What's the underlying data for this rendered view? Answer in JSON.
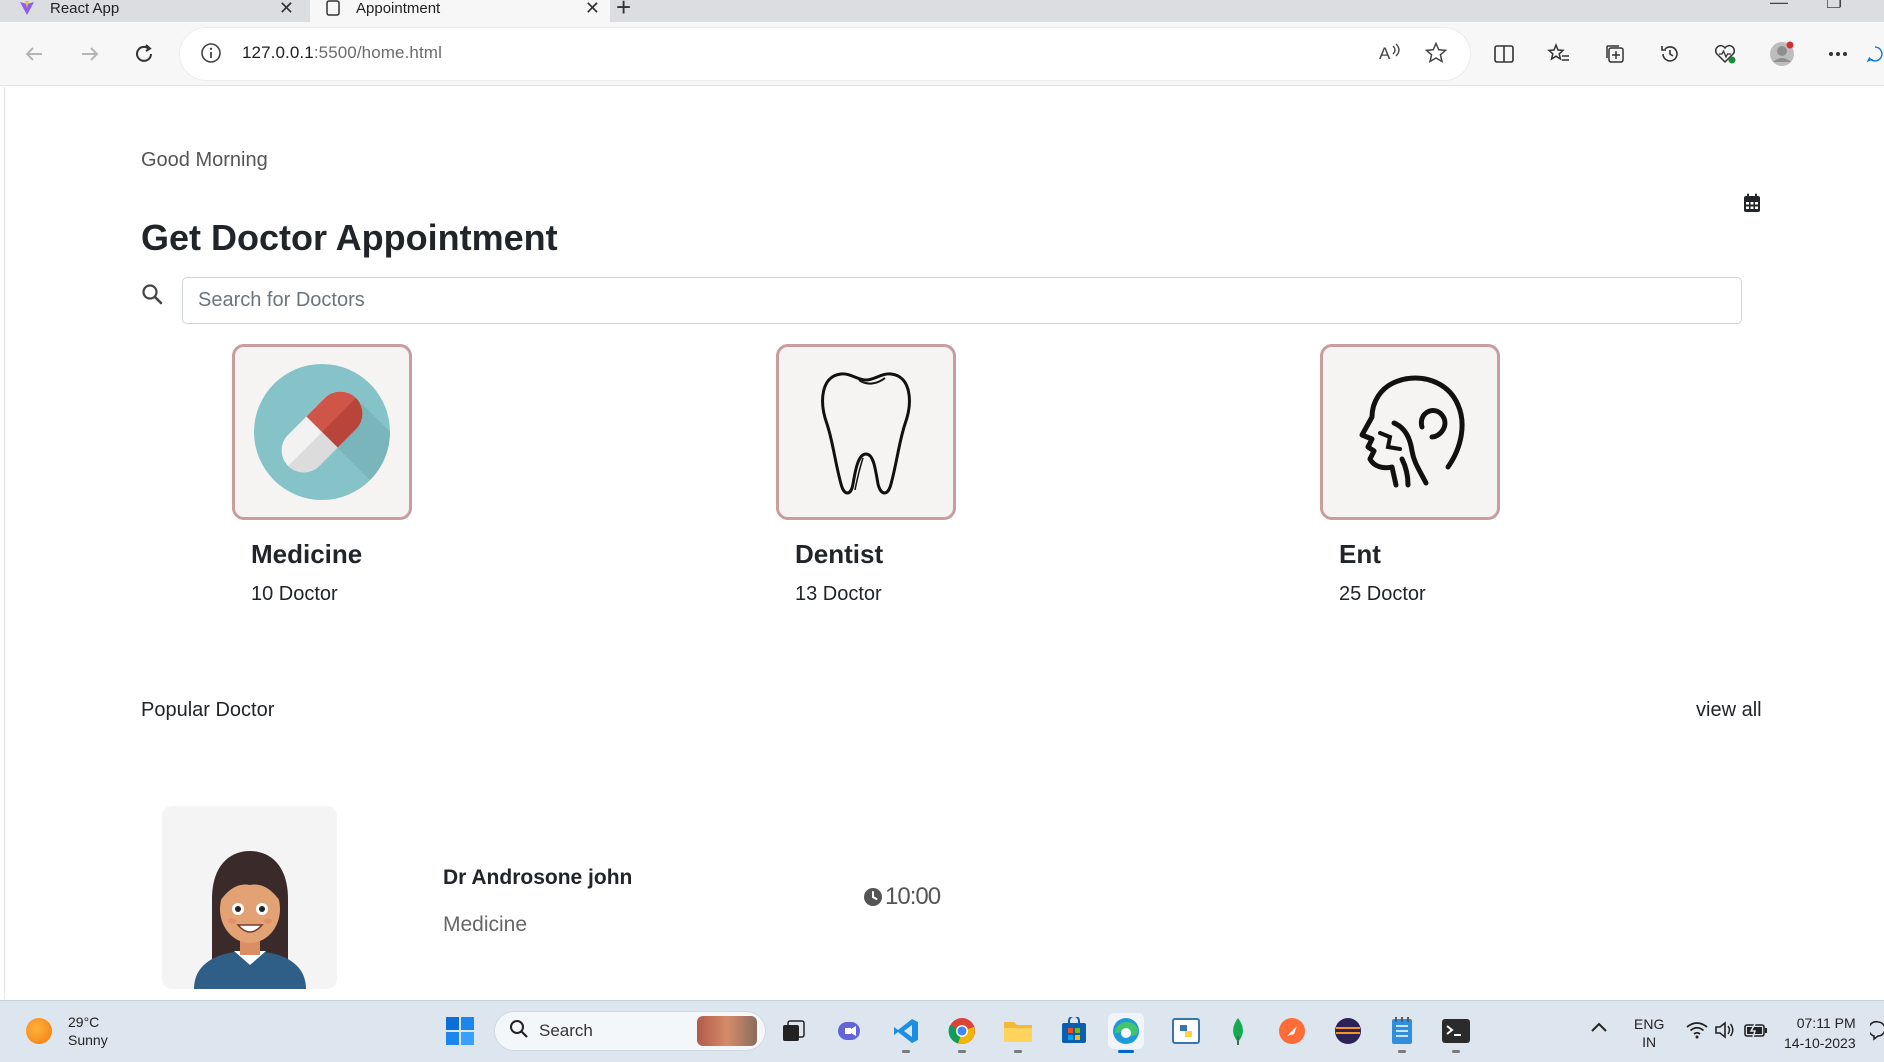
{
  "browser": {
    "tabs": [
      {
        "label": "React App",
        "active": false
      },
      {
        "label": "Appointment",
        "active": true
      }
    ],
    "url_host": "127.0.0.1",
    "url_path": ":5500/home.html"
  },
  "page": {
    "greeting": "Good Morning",
    "title": "Get Doctor Appointment",
    "search_placeholder": "Search for Doctors",
    "categories": [
      {
        "name": "Medicine",
        "count": "10 Doctor",
        "icon": "pill-icon"
      },
      {
        "name": "Dentist",
        "count": "13 Doctor",
        "icon": "tooth-icon"
      },
      {
        "name": "Ent",
        "count": "25 Doctor",
        "icon": "ent-head-icon"
      }
    ],
    "popular_label": "Popular Doctor",
    "view_all": "view all",
    "doctors": [
      {
        "name": "Dr Androsone john",
        "specialty": "Medicine",
        "time": "10:00"
      }
    ]
  },
  "taskbar": {
    "weather_temp": "29°C",
    "weather_desc": "Sunny",
    "search_label": "Search",
    "lang_1": "ENG",
    "lang_2": "IN",
    "time": "07:11 PM",
    "date": "14-10-2023"
  },
  "colors": {
    "card_border": "#c89da0",
    "card_bg": "#f6f4f3",
    "pill_circle": "#86c3c9",
    "pill_red": "#cf5549",
    "taskbar_bg": "#dde6ef"
  }
}
